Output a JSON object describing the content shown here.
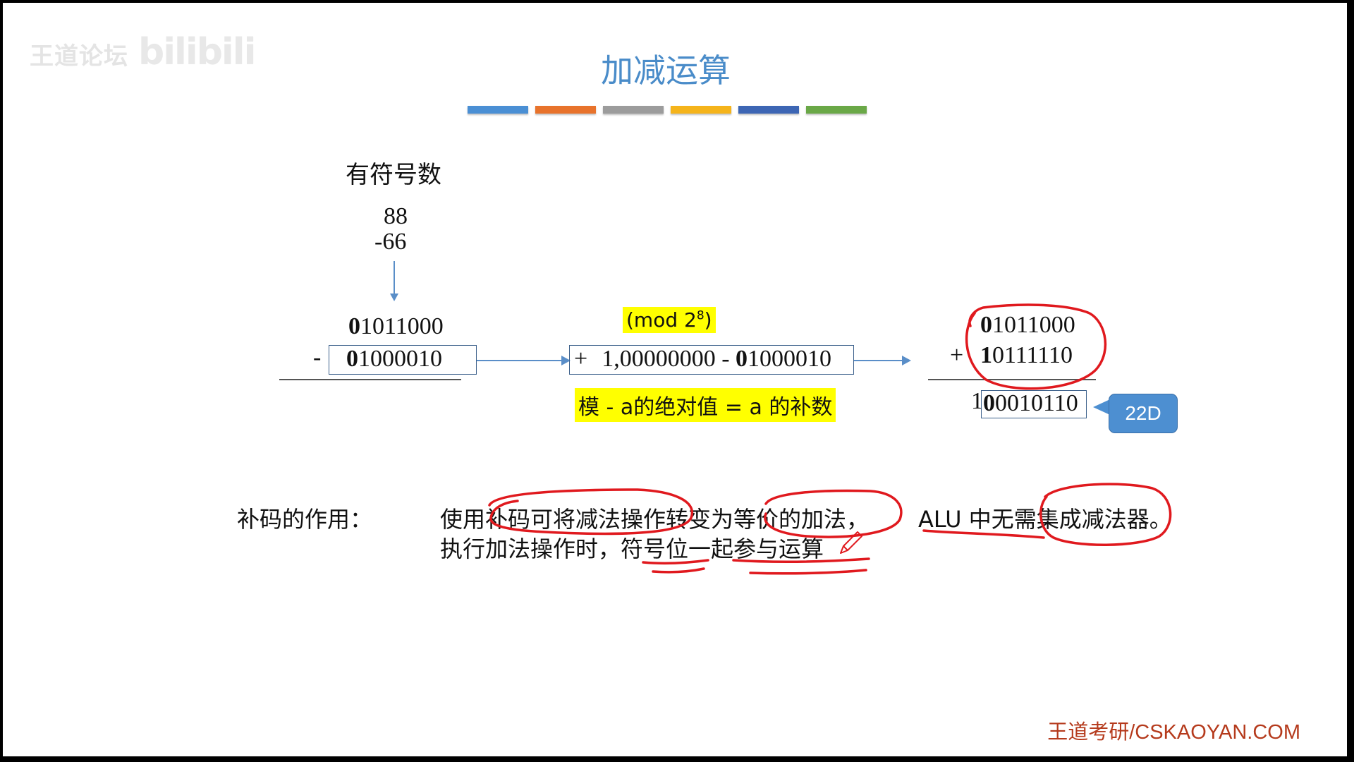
{
  "watermark": {
    "text": "王道论坛",
    "logo": "bilibili"
  },
  "title": "加减运算",
  "accent_bars": [
    "#4a8fd4",
    "#e8732c",
    "#9c9c9c",
    "#f5b41b",
    "#3d66b4",
    "#6aa847"
  ],
  "left_block": {
    "heading": "有符号数",
    "num1": "88",
    "num2": "-66",
    "op_minus": "-",
    "bin1": {
      "first": "0",
      "rest": "1011000"
    },
    "bin2": {
      "first": "0",
      "rest": "1000010"
    }
  },
  "middle_block": {
    "mod_label": {
      "text": "(mod 2",
      "exp": "8",
      "close": ")"
    },
    "expr": {
      "plus": "+",
      "a": "1,00000000 - ",
      "b_first": "0",
      "b_rest": "1000010"
    },
    "note": "模 - a的绝对值 = a 的补数"
  },
  "right_block": {
    "op_plus": "+",
    "bin1": {
      "first": "0",
      "rest": "1011000"
    },
    "bin2": {
      "first": "1",
      "rest": "0111110"
    },
    "result": {
      "carry": "1",
      "first": "0",
      "rest": "0010110"
    },
    "callout": "22D"
  },
  "bottom_text": {
    "label": "补码的作用：",
    "line1a": "使用补码可将减法操作转变为等价的加法，",
    "line1b": "ALU 中无需集成减法器。",
    "line2": "执行加法操作时，符号位一起参与运算"
  },
  "footer": "王道考研/CSKAOYAN.COM",
  "annotation_color": "#e0191e"
}
